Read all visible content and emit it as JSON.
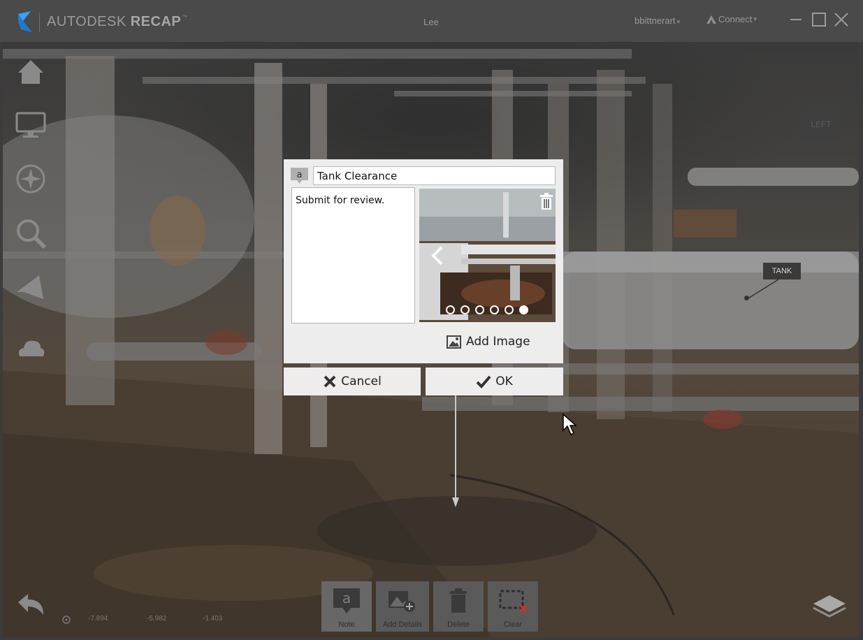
{
  "window": {
    "brand": "AUTODESK",
    "product": "RECAP",
    "trademark": "™",
    "document_title": "Lee",
    "user": "bbittnerart",
    "connect": "Connect",
    "minimize_icon": "minimize-icon",
    "maximize_icon": "maximize-icon",
    "close_icon": "close-icon"
  },
  "left_toolbar": {
    "items": [
      "home-icon",
      "display-icon",
      "navigate-icon",
      "search-icon",
      "measure-icon",
      "cloud-icon"
    ],
    "undo_icon": "undo-icon"
  },
  "viewcube": {
    "face": "LEFT"
  },
  "coordinates": {
    "x": "-7.894",
    "y": "-5.982",
    "z": "-1.403"
  },
  "scene_label": {
    "text": "TANK"
  },
  "note_dialog": {
    "title_value": "Tank Clearance",
    "description": "Submit for review.",
    "image_count": 6,
    "active_image_index": 5,
    "add_image_label": "Add Image"
  },
  "actions": {
    "cancel_label": "Cancel",
    "ok_label": "OK"
  },
  "bottom_toolbar": {
    "note_label": "Note",
    "add_details_label": "Add Details",
    "delete_label": "Delete",
    "clear_label": "Clear"
  },
  "colors": {
    "dialog_bg": "#ededed",
    "titlebar_bg": "#4a4a4a",
    "toolbar_button": "#5a5a5a",
    "clear_accent": "#c0392b"
  }
}
